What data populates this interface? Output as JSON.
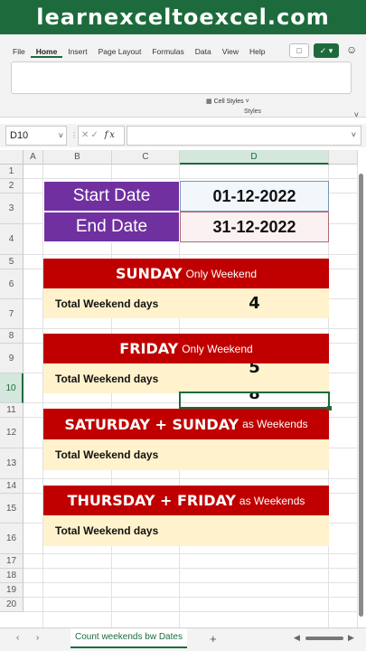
{
  "banner": {
    "text": "learnexceltoexcel.com"
  },
  "ribbon": {
    "tabs": [
      "File",
      "Home",
      "Insert",
      "Page Layout",
      "Formulas",
      "Data",
      "View",
      "Help"
    ],
    "active_tab": "Home",
    "cell_styles_label": "Cell Styles",
    "group_label": "Styles"
  },
  "formula_bar": {
    "name_box": "D10",
    "fx_label": "fx",
    "formula": ""
  },
  "grid": {
    "columns": [
      "A",
      "B",
      "C",
      "D"
    ],
    "rows": [
      "1",
      "2",
      "3",
      "4",
      "5",
      "6",
      "7",
      "8",
      "9",
      "10",
      "11",
      "12",
      "13",
      "14",
      "15",
      "16",
      "17",
      "18",
      "19",
      "20"
    ],
    "selected_column": "D",
    "selected_row": "10"
  },
  "sheet": {
    "start_label": "Start Date",
    "start_value": "01-12-2022",
    "end_label": "End Date",
    "end_value": "31-12-2022",
    "sections": [
      {
        "title": "SUNDAY",
        "suffix": "Only Weekend",
        "label": "Total Weekend days",
        "value": "4"
      },
      {
        "title": "FRIDAY",
        "suffix": "Only Weekend",
        "label": "Total Weekend days",
        "value": "5"
      },
      {
        "title": "SATURDAY + SUNDAY",
        "suffix": "as Weekends",
        "label": "Total Weekend days",
        "value": ""
      },
      {
        "title": "THURSDAY + FRIDAY",
        "suffix": "as Weekends",
        "label": "Total Weekend days",
        "value": ""
      }
    ],
    "partial_value_row10": "8"
  },
  "sheet_tabs": {
    "active": "Count weekends bw Dates",
    "add_label": "+"
  },
  "colors": {
    "excel_green": "#1d6b3c",
    "purple": "#7030a0",
    "red": "#c00000",
    "light_yellow": "#fff2cc"
  }
}
